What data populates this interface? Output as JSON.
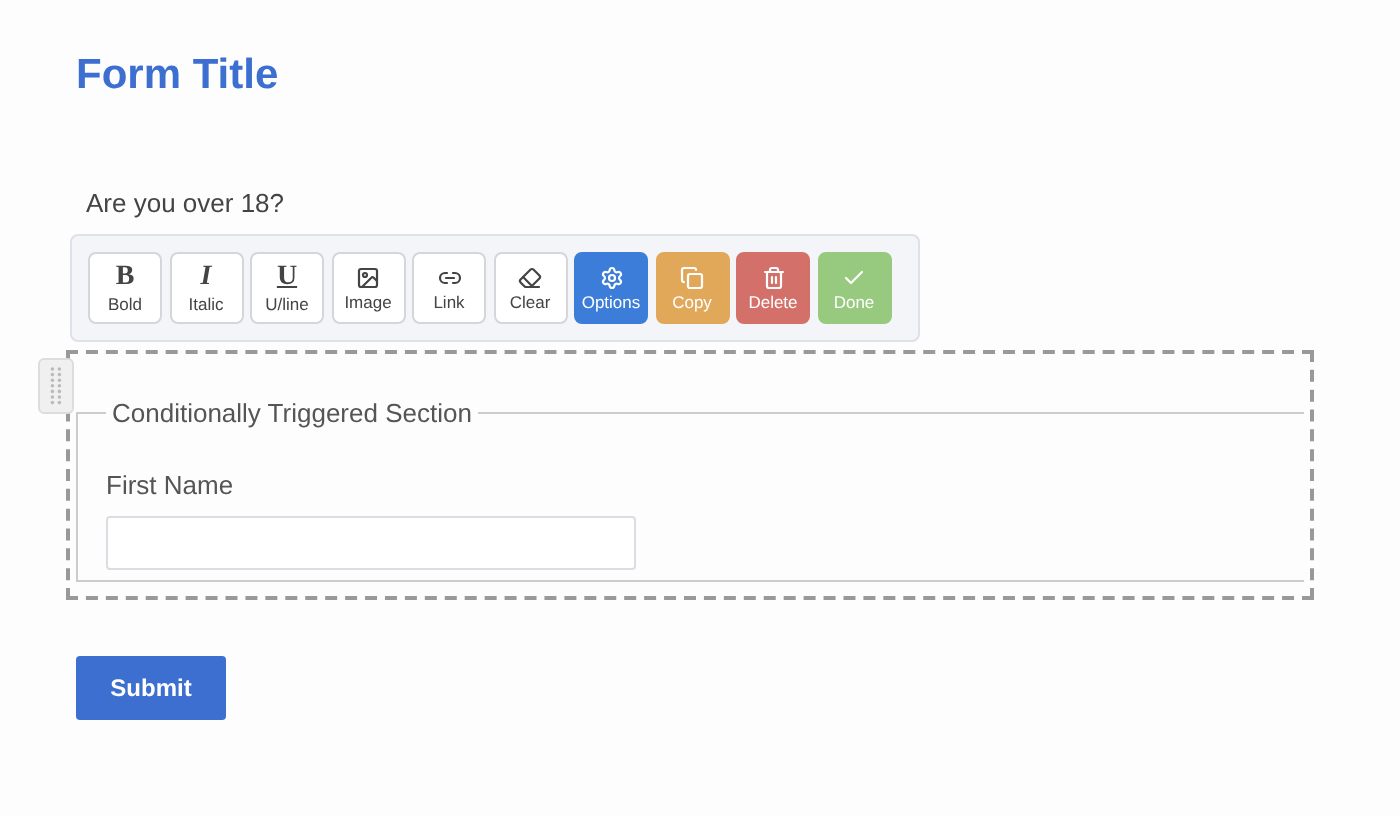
{
  "form_title": "Form Title",
  "question": "Are you over 18?",
  "toolbar": [
    {
      "kind": "bold",
      "label": "Bold",
      "glyph": "B"
    },
    {
      "kind": "italic",
      "label": "Italic",
      "glyph": "I"
    },
    {
      "kind": "underline",
      "label": "U/line",
      "glyph": "U"
    },
    {
      "kind": "image",
      "label": "Image"
    },
    {
      "kind": "link",
      "label": "Link"
    },
    {
      "kind": "clear",
      "label": "Clear"
    },
    {
      "kind": "options",
      "label": "Options",
      "color": "#3b7dd8"
    },
    {
      "kind": "copy",
      "label": "Copy",
      "color": "#e2a85a"
    },
    {
      "kind": "delete",
      "label": "Delete",
      "color": "#d4706a"
    },
    {
      "kind": "done",
      "label": "Done",
      "color": "#97c97f"
    }
  ],
  "section": {
    "legend": "Conditionally Triggered Section",
    "field_label": "First Name"
  },
  "submit": "Submit"
}
